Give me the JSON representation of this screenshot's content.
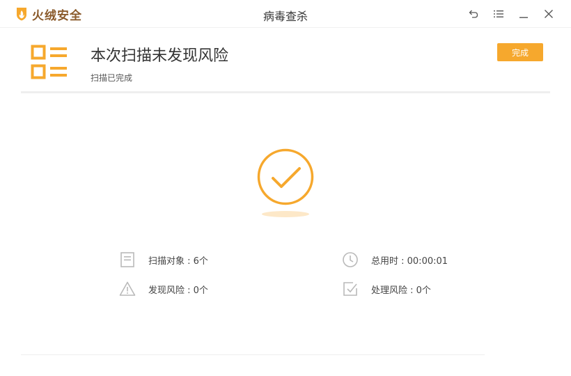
{
  "titlebar": {
    "brand_name": "火绒安全",
    "window_title": "病毒查杀",
    "controls": {
      "back_icon": "back-arrow-icon",
      "menu_icon": "menu-icon",
      "minimize_icon": "minimize-icon",
      "close_icon": "close-icon"
    }
  },
  "header": {
    "title": "本次扫描未发现风险",
    "subtitle": "扫描已完成",
    "done_label": "完成",
    "icon": "scan-report-icon"
  },
  "result": {
    "icon": "check-circle-icon"
  },
  "stats": {
    "scanned_label": "扫描对象 : 6个",
    "found_label": "发现风险 : 0个",
    "time_label": "总用时 : 00:00:01",
    "handled_label": "处理风险 : 0个"
  },
  "colors": {
    "accent": "#f6a82d",
    "brand_text": "#8a5a2b",
    "icon_gray": "#b9b9b9",
    "divider": "#eeeeee"
  }
}
